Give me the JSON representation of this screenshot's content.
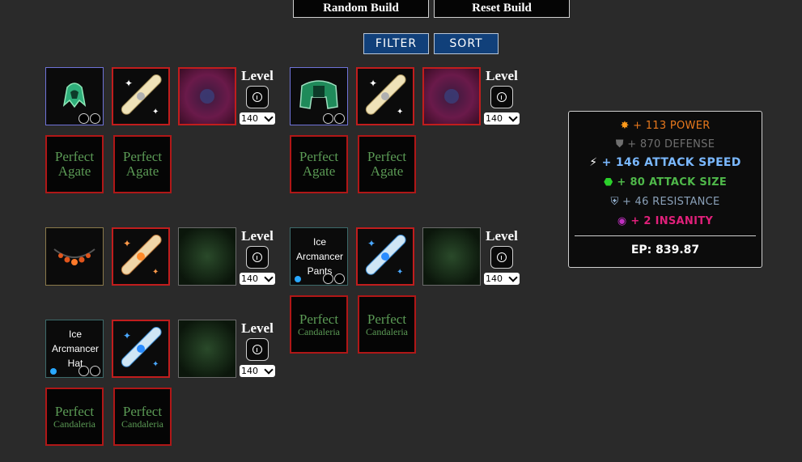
{
  "top_buttons": {
    "random": "Random Build",
    "reset": "Reset Build"
  },
  "controls": {
    "filter": "FILTER",
    "sort": "SORT"
  },
  "level_label": "Level",
  "level_value": "140",
  "gems": {
    "perfect": "Perfect",
    "agate": "Agate",
    "candaleria": "Candaleria"
  },
  "items": {
    "pants_name": "Ice Arcmancer Pants",
    "hat_name": "Ice Arcmancer Hat"
  },
  "stats": {
    "power": "+ 113 POWER",
    "defense": "+ 870 DEFENSE",
    "attack_speed": "+ 146 ATTACK SPEED",
    "attack_size": "+ 80 ATTACK SIZE",
    "resistance": "+ 46 RESISTANCE",
    "insanity": "+ 2 INSANITY",
    "ep": "EP: 839.87"
  },
  "colors": {
    "power": "#e8781c",
    "defense": "#6f6f6f",
    "attack_speed": "#7ab8ff",
    "attack_size": "#4fb84a",
    "resistance": "#8aa0b8",
    "insanity": "#e0207a"
  }
}
